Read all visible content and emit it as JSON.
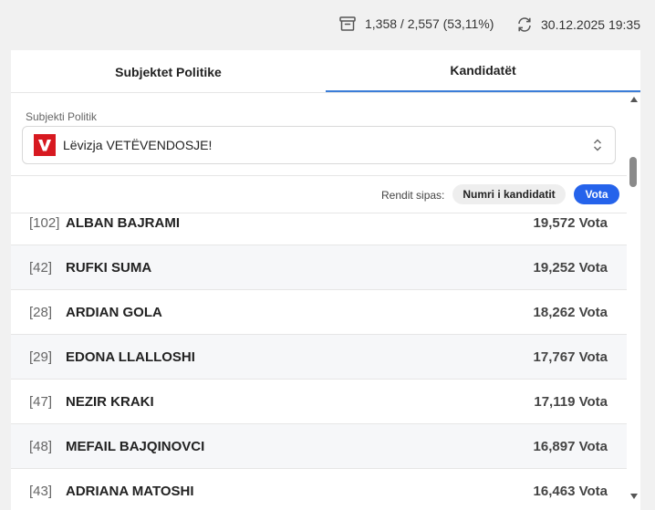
{
  "header": {
    "counts": "1,358 / 2,557 (53,11%)",
    "archive_icon": "archive-box-icon",
    "timestamp": "30.12.2025 19:35",
    "refresh_icon": "refresh-icon"
  },
  "tabs": [
    {
      "label": "Subjektet Politike",
      "active": false
    },
    {
      "label": "Kandidatët",
      "active": true
    }
  ],
  "selector": {
    "label": "Subjekti Politik",
    "logo_letter": "V",
    "value": "Lëvizja VETËVENDOSJE!"
  },
  "sort": {
    "label": "Rendit sipas:",
    "options": [
      {
        "label": "Numri i kandidatit",
        "selected": false
      },
      {
        "label": "Vota",
        "selected": true
      }
    ]
  },
  "candidates": [
    {
      "number": "[102]",
      "name": "ALBAN BAJRAMI",
      "votes": "19,572 Vota"
    },
    {
      "number": "[42]",
      "name": "RUFKI SUMA",
      "votes": "19,252 Vota"
    },
    {
      "number": "[28]",
      "name": "ARDIAN GOLA",
      "votes": "18,262 Vota"
    },
    {
      "number": "[29]",
      "name": "EDONA LLALLOSHI",
      "votes": "17,767 Vota"
    },
    {
      "number": "[47]",
      "name": "NEZIR KRAKI",
      "votes": "17,119 Vota"
    },
    {
      "number": "[48]",
      "name": "MEFAIL BAJQINOVCI",
      "votes": "16,897 Vota"
    },
    {
      "number": "[43]",
      "name": "ADRIANA MATOSHI",
      "votes": "16,463 Vota"
    }
  ],
  "colors": {
    "accent": "#2563eb",
    "tab_underline": "#3b7dd8",
    "party_red": "#d71920"
  }
}
